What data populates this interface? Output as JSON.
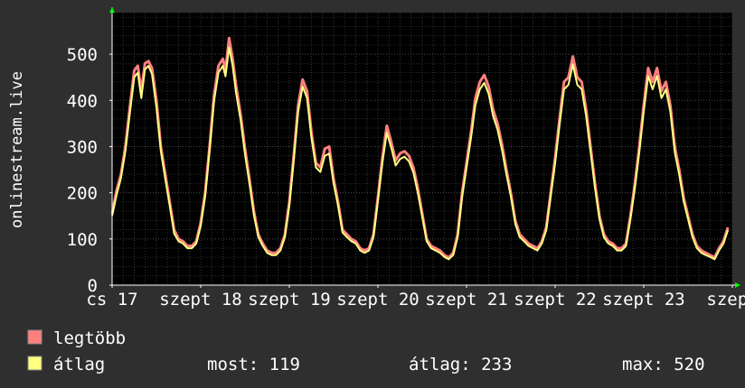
{
  "chart_data": {
    "type": "area",
    "ylabel": "onlinestream.live",
    "ylim": [
      0,
      590
    ],
    "yticks": [
      0,
      100,
      200,
      300,
      400,
      500
    ],
    "xlim": [
      0,
      7
    ],
    "xticks": [
      {
        "x": 0.0,
        "label": "cs 17"
      },
      {
        "x": 1.0,
        "label": "szept 18"
      },
      {
        "x": 2.0,
        "label": "szept 19"
      },
      {
        "x": 3.0,
        "label": "szept 20"
      },
      {
        "x": 4.0,
        "label": "szept 21"
      },
      {
        "x": 5.0,
        "label": "szept 22"
      },
      {
        "x": 6.0,
        "label": "szept 23"
      },
      {
        "x": 7.0,
        "label": "szept"
      }
    ],
    "grid": true,
    "legend_position": "bottom-left",
    "series": [
      {
        "name": "legtöbb",
        "color": "#ff7f7f",
        "points": [
          [
            0.0,
            155
          ],
          [
            0.05,
            205
          ],
          [
            0.1,
            240
          ],
          [
            0.15,
            300
          ],
          [
            0.2,
            385
          ],
          [
            0.25,
            465
          ],
          [
            0.29,
            475
          ],
          [
            0.33,
            420
          ],
          [
            0.37,
            480
          ],
          [
            0.41,
            485
          ],
          [
            0.45,
            470
          ],
          [
            0.5,
            400
          ],
          [
            0.55,
            300
          ],
          [
            0.6,
            240
          ],
          [
            0.65,
            180
          ],
          [
            0.7,
            120
          ],
          [
            0.75,
            100
          ],
          [
            0.8,
            95
          ],
          [
            0.85,
            85
          ],
          [
            0.9,
            85
          ],
          [
            0.95,
            95
          ],
          [
            1.0,
            135
          ],
          [
            1.05,
            200
          ],
          [
            1.1,
            300
          ],
          [
            1.15,
            410
          ],
          [
            1.2,
            475
          ],
          [
            1.25,
            490
          ],
          [
            1.28,
            465
          ],
          [
            1.32,
            535
          ],
          [
            1.36,
            490
          ],
          [
            1.4,
            430
          ],
          [
            1.45,
            370
          ],
          [
            1.5,
            295
          ],
          [
            1.55,
            230
          ],
          [
            1.6,
            160
          ],
          [
            1.65,
            110
          ],
          [
            1.7,
            90
          ],
          [
            1.75,
            75
          ],
          [
            1.8,
            70
          ],
          [
            1.85,
            70
          ],
          [
            1.9,
            80
          ],
          [
            1.95,
            110
          ],
          [
            2.0,
            180
          ],
          [
            2.05,
            280
          ],
          [
            2.1,
            390
          ],
          [
            2.15,
            445
          ],
          [
            2.2,
            420
          ],
          [
            2.25,
            330
          ],
          [
            2.3,
            265
          ],
          [
            2.35,
            255
          ],
          [
            2.4,
            295
          ],
          [
            2.45,
            300
          ],
          [
            2.5,
            230
          ],
          [
            2.55,
            180
          ],
          [
            2.6,
            120
          ],
          [
            2.65,
            110
          ],
          [
            2.7,
            100
          ],
          [
            2.75,
            95
          ],
          [
            2.8,
            80
          ],
          [
            2.85,
            75
          ],
          [
            2.9,
            80
          ],
          [
            2.95,
            110
          ],
          [
            3.0,
            190
          ],
          [
            3.05,
            275
          ],
          [
            3.1,
            345
          ],
          [
            3.15,
            310
          ],
          [
            3.2,
            270
          ],
          [
            3.25,
            285
          ],
          [
            3.3,
            290
          ],
          [
            3.35,
            280
          ],
          [
            3.4,
            255
          ],
          [
            3.45,
            210
          ],
          [
            3.5,
            155
          ],
          [
            3.55,
            100
          ],
          [
            3.6,
            85
          ],
          [
            3.65,
            80
          ],
          [
            3.7,
            75
          ],
          [
            3.75,
            65
          ],
          [
            3.8,
            60
          ],
          [
            3.85,
            70
          ],
          [
            3.9,
            110
          ],
          [
            3.95,
            200
          ],
          [
            4.0,
            265
          ],
          [
            4.05,
            330
          ],
          [
            4.1,
            405
          ],
          [
            4.15,
            440
          ],
          [
            4.2,
            455
          ],
          [
            4.25,
            430
          ],
          [
            4.3,
            380
          ],
          [
            4.35,
            350
          ],
          [
            4.4,
            305
          ],
          [
            4.45,
            250
          ],
          [
            4.5,
            200
          ],
          [
            4.55,
            140
          ],
          [
            4.6,
            110
          ],
          [
            4.65,
            100
          ],
          [
            4.7,
            90
          ],
          [
            4.75,
            85
          ],
          [
            4.8,
            80
          ],
          [
            4.85,
            95
          ],
          [
            4.9,
            125
          ],
          [
            4.95,
            200
          ],
          [
            5.0,
            275
          ],
          [
            5.05,
            360
          ],
          [
            5.1,
            440
          ],
          [
            5.15,
            450
          ],
          [
            5.2,
            495
          ],
          [
            5.25,
            450
          ],
          [
            5.3,
            440
          ],
          [
            5.35,
            380
          ],
          [
            5.4,
            300
          ],
          [
            5.45,
            220
          ],
          [
            5.5,
            150
          ],
          [
            5.55,
            110
          ],
          [
            5.6,
            95
          ],
          [
            5.65,
            90
          ],
          [
            5.7,
            80
          ],
          [
            5.75,
            80
          ],
          [
            5.8,
            90
          ],
          [
            5.85,
            150
          ],
          [
            5.9,
            220
          ],
          [
            5.95,
            300
          ],
          [
            6.0,
            390
          ],
          [
            6.05,
            470
          ],
          [
            6.1,
            440
          ],
          [
            6.15,
            470
          ],
          [
            6.2,
            420
          ],
          [
            6.25,
            440
          ],
          [
            6.3,
            390
          ],
          [
            6.35,
            300
          ],
          [
            6.4,
            250
          ],
          [
            6.45,
            190
          ],
          [
            6.5,
            150
          ],
          [
            6.55,
            110
          ],
          [
            6.6,
            85
          ],
          [
            6.65,
            75
          ],
          [
            6.7,
            70
          ],
          [
            6.75,
            65
          ],
          [
            6.8,
            60
          ],
          [
            6.85,
            80
          ],
          [
            6.9,
            95
          ],
          [
            6.95,
            125
          ]
        ]
      },
      {
        "name": "átlag",
        "color": "#ffff80",
        "points": [
          [
            0.0,
            150
          ],
          [
            0.05,
            195
          ],
          [
            0.1,
            232
          ],
          [
            0.15,
            290
          ],
          [
            0.2,
            372
          ],
          [
            0.25,
            450
          ],
          [
            0.29,
            460
          ],
          [
            0.33,
            405
          ],
          [
            0.37,
            467
          ],
          [
            0.41,
            475
          ],
          [
            0.45,
            457
          ],
          [
            0.5,
            385
          ],
          [
            0.55,
            290
          ],
          [
            0.6,
            230
          ],
          [
            0.65,
            172
          ],
          [
            0.7,
            112
          ],
          [
            0.75,
            95
          ],
          [
            0.8,
            90
          ],
          [
            0.85,
            80
          ],
          [
            0.9,
            80
          ],
          [
            0.95,
            90
          ],
          [
            1.0,
            128
          ],
          [
            1.05,
            192
          ],
          [
            1.1,
            290
          ],
          [
            1.15,
            398
          ],
          [
            1.2,
            460
          ],
          [
            1.25,
            475
          ],
          [
            1.28,
            452
          ],
          [
            1.32,
            515
          ],
          [
            1.36,
            475
          ],
          [
            1.4,
            415
          ],
          [
            1.45,
            358
          ],
          [
            1.5,
            283
          ],
          [
            1.55,
            220
          ],
          [
            1.6,
            152
          ],
          [
            1.65,
            104
          ],
          [
            1.7,
            85
          ],
          [
            1.75,
            70
          ],
          [
            1.8,
            65
          ],
          [
            1.85,
            65
          ],
          [
            1.9,
            75
          ],
          [
            1.95,
            104
          ],
          [
            2.0,
            172
          ],
          [
            2.05,
            270
          ],
          [
            2.1,
            376
          ],
          [
            2.15,
            430
          ],
          [
            2.2,
            405
          ],
          [
            2.25,
            318
          ],
          [
            2.3,
            255
          ],
          [
            2.35,
            245
          ],
          [
            2.4,
            280
          ],
          [
            2.45,
            285
          ],
          [
            2.5,
            220
          ],
          [
            2.55,
            172
          ],
          [
            2.6,
            114
          ],
          [
            2.65,
            104
          ],
          [
            2.7,
            95
          ],
          [
            2.75,
            90
          ],
          [
            2.8,
            75
          ],
          [
            2.85,
            70
          ],
          [
            2.9,
            75
          ],
          [
            2.95,
            104
          ],
          [
            3.0,
            182
          ],
          [
            3.05,
            264
          ],
          [
            3.1,
            330
          ],
          [
            3.15,
            298
          ],
          [
            3.2,
            259
          ],
          [
            3.25,
            273
          ],
          [
            3.3,
            278
          ],
          [
            3.35,
            268
          ],
          [
            3.4,
            244
          ],
          [
            3.45,
            200
          ],
          [
            3.5,
            148
          ],
          [
            3.55,
            95
          ],
          [
            3.6,
            80
          ],
          [
            3.65,
            75
          ],
          [
            3.7,
            70
          ],
          [
            3.75,
            61
          ],
          [
            3.8,
            56
          ],
          [
            3.85,
            65
          ],
          [
            3.9,
            104
          ],
          [
            3.95,
            190
          ],
          [
            4.0,
            254
          ],
          [
            4.05,
            318
          ],
          [
            4.1,
            390
          ],
          [
            4.15,
            424
          ],
          [
            4.2,
            438
          ],
          [
            4.25,
            414
          ],
          [
            4.3,
            366
          ],
          [
            4.35,
            337
          ],
          [
            4.4,
            293
          ],
          [
            4.45,
            240
          ],
          [
            4.5,
            192
          ],
          [
            4.55,
            133
          ],
          [
            4.6,
            104
          ],
          [
            4.65,
            95
          ],
          [
            4.7,
            85
          ],
          [
            4.75,
            80
          ],
          [
            4.8,
            75
          ],
          [
            4.85,
            90
          ],
          [
            4.9,
            119
          ],
          [
            4.95,
            192
          ],
          [
            5.0,
            264
          ],
          [
            5.05,
            347
          ],
          [
            5.1,
            424
          ],
          [
            5.15,
            434
          ],
          [
            5.2,
            478
          ],
          [
            5.25,
            434
          ],
          [
            5.3,
            424
          ],
          [
            5.35,
            366
          ],
          [
            5.4,
            288
          ],
          [
            5.45,
            210
          ],
          [
            5.5,
            143
          ],
          [
            5.55,
            104
          ],
          [
            5.6,
            90
          ],
          [
            5.65,
            85
          ],
          [
            5.7,
            75
          ],
          [
            5.75,
            75
          ],
          [
            5.8,
            85
          ],
          [
            5.85,
            143
          ],
          [
            5.9,
            210
          ],
          [
            5.95,
            288
          ],
          [
            6.0,
            376
          ],
          [
            6.05,
            453
          ],
          [
            6.1,
            424
          ],
          [
            6.15,
            453
          ],
          [
            6.2,
            405
          ],
          [
            6.25,
            424
          ],
          [
            6.3,
            376
          ],
          [
            6.35,
            288
          ],
          [
            6.4,
            240
          ],
          [
            6.45,
            182
          ],
          [
            6.5,
            143
          ],
          [
            6.55,
            104
          ],
          [
            6.6,
            80
          ],
          [
            6.65,
            70
          ],
          [
            6.7,
            65
          ],
          [
            6.75,
            61
          ],
          [
            6.8,
            56
          ],
          [
            6.85,
            75
          ],
          [
            6.9,
            90
          ],
          [
            6.95,
            119
          ]
        ]
      }
    ]
  },
  "legend": {
    "items": [
      {
        "label": "legtöbb",
        "color": "#ff7f7f"
      },
      {
        "label": "átlag",
        "color": "#ffff80"
      }
    ],
    "stats": {
      "most": "most: 119",
      "atlag": "átlag: 233",
      "max": "max: 520"
    }
  },
  "colors": {
    "background": "#2f2f2f",
    "plot_background": "#000000",
    "grid": "#4a4a4a",
    "axis": "#ffffff",
    "axis_marker": "#00ff00"
  }
}
